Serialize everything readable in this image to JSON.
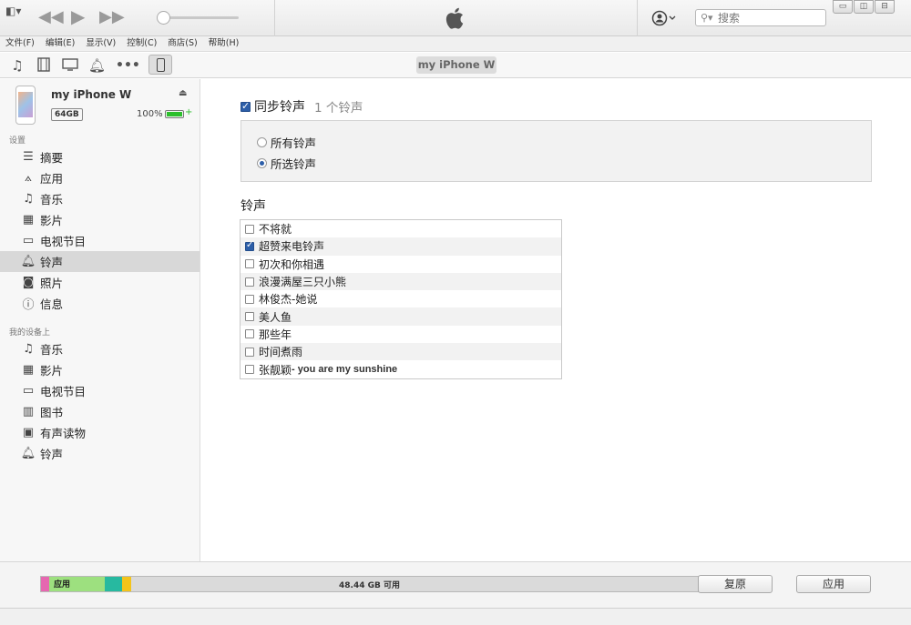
{
  "player": {
    "search_placeholder": "搜索"
  },
  "menubar": [
    "文件(F)",
    "编辑(E)",
    "显示(V)",
    "控制(C)",
    "商店(S)",
    "帮助(H)"
  ],
  "toolbar": {
    "device_pill": "my iPhone W"
  },
  "device": {
    "name": "my iPhone W",
    "capacity": "64GB",
    "battery_pct": "100%",
    "battery_level": 1.0
  },
  "sidebar": {
    "settings_header": "设置",
    "settings_items": [
      {
        "label": "摘要",
        "icon": "list-icon"
      },
      {
        "label": "应用",
        "icon": "apps-icon"
      },
      {
        "label": "音乐",
        "icon": "music-note-icon"
      },
      {
        "label": "影片",
        "icon": "film-icon"
      },
      {
        "label": "电视节目",
        "icon": "tv-icon"
      },
      {
        "label": "铃声",
        "icon": "bell-icon",
        "selected": true
      },
      {
        "label": "照片",
        "icon": "camera-icon"
      },
      {
        "label": "信息",
        "icon": "info-icon"
      }
    ],
    "ondevice_header": "我的设备上",
    "ondevice_items": [
      {
        "label": "音乐",
        "icon": "music-note-icon"
      },
      {
        "label": "影片",
        "icon": "film-icon"
      },
      {
        "label": "电视节目",
        "icon": "tv-icon"
      },
      {
        "label": "图书",
        "icon": "book-icon"
      },
      {
        "label": "有声读物",
        "icon": "audiobook-icon"
      },
      {
        "label": "铃声",
        "icon": "bell-icon"
      }
    ]
  },
  "main": {
    "sync_label": "同步铃声",
    "sync_checked": true,
    "sync_count": "1 个铃声",
    "radio_all": "所有铃声",
    "radio_selected": "所选铃声",
    "selected_option": "selected",
    "ringtones_title": "铃声",
    "ringtones": [
      {
        "name": "不将就",
        "checked": false
      },
      {
        "name": "超赞来电铃声",
        "checked": true
      },
      {
        "name": "初次和你相遇",
        "checked": false
      },
      {
        "name": "浪漫满屋三只小熊",
        "checked": false
      },
      {
        "name": "林俊杰-她说",
        "checked": false
      },
      {
        "name": "美人鱼",
        "checked": false
      },
      {
        "name": "那些年",
        "checked": false
      },
      {
        "name": "时间煮雨",
        "checked": false
      },
      {
        "name": "张靓颖",
        "suffix": " - you are my sunshine",
        "checked": false
      }
    ]
  },
  "storage": {
    "apps_label": "应用",
    "free_label": "48.44 GB 可用",
    "segments": [
      {
        "name": "other-pink",
        "color": "#e667b0",
        "fraction": 0.012
      },
      {
        "name": "apps",
        "color": "#9de07f",
        "fraction": 0.085
      },
      {
        "name": "teal",
        "color": "#27b9a0",
        "fraction": 0.027
      },
      {
        "name": "yellow",
        "color": "#f4c41b",
        "fraction": 0.014
      }
    ],
    "revert_button": "复原",
    "apply_button": "应用"
  }
}
